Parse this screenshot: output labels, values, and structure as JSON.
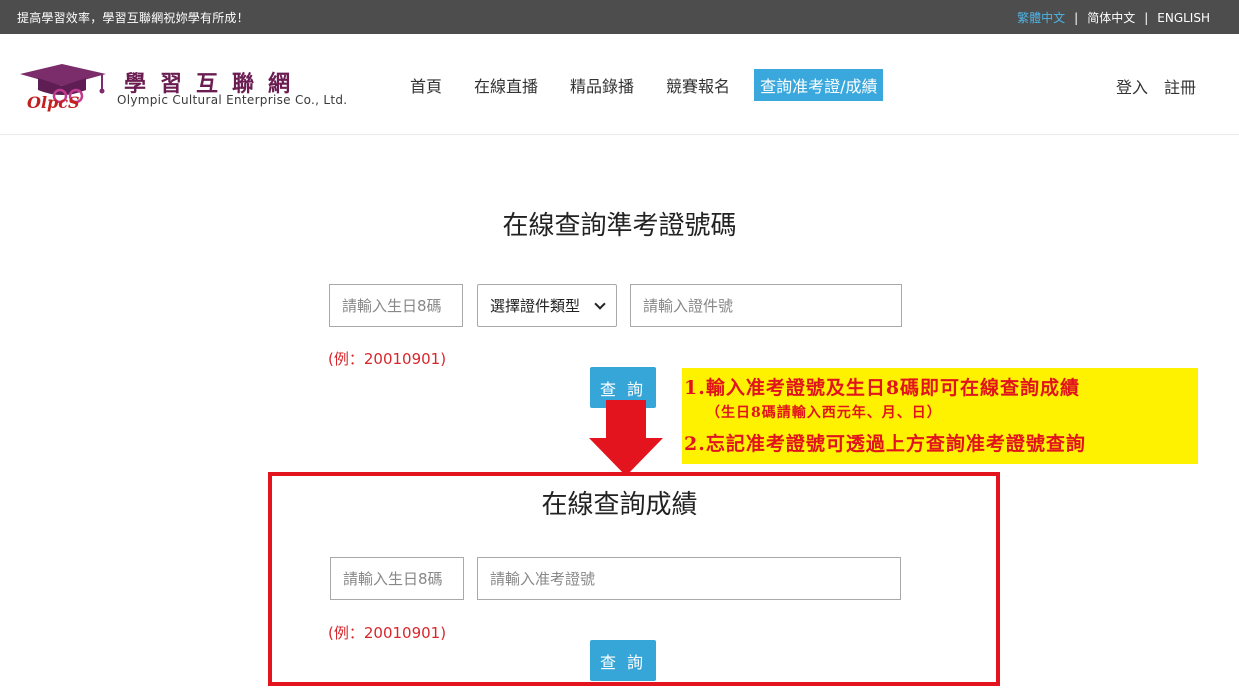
{
  "topbar": {
    "slogan": "提高學習效率，學習互聯網祝妳學有所成！",
    "languages": [
      "繁體中文",
      "简体中文",
      "ENGLISH"
    ],
    "separator": "|"
  },
  "brand": {
    "logo_text": "OlpcS",
    "name": "學習互聯網",
    "subtitle": "Olympic Cultural Enterprise Co., Ltd."
  },
  "nav": {
    "items": [
      "首頁",
      "在線直播",
      "精品錄播",
      "競賽報名",
      "查詢准考證/成績"
    ]
  },
  "auth": {
    "login": "登入",
    "register": "註冊"
  },
  "query_ticket": {
    "title": "在線查詢準考證號碼",
    "birthday_placeholder": "請輸入生日8碼",
    "id_type_selected": "選擇證件類型",
    "id_number_placeholder": "請輸入證件號",
    "example": "(例：20010901)",
    "button": "查 詢"
  },
  "note": {
    "line1": "1.輸入准考證號及生日8碼即可在線查詢成績",
    "line2": "（生日8碼請輸入西元年、月、日）",
    "line3": "2.忘記准考證號可透過上方查詢准考證號查詢"
  },
  "query_score": {
    "title": "在線查詢成績",
    "birthday_placeholder": "請輸入生日8碼",
    "ticket_placeholder": "請輸入准考證號",
    "example": "(例：20010901)",
    "button": "查 詢"
  },
  "colors": {
    "topbar_bg": "#4d4d4d",
    "accent": "#36a6d9",
    "highlight": "#fff200",
    "warning_red": "#e3141d",
    "brand_purple": "#6b1d52"
  }
}
